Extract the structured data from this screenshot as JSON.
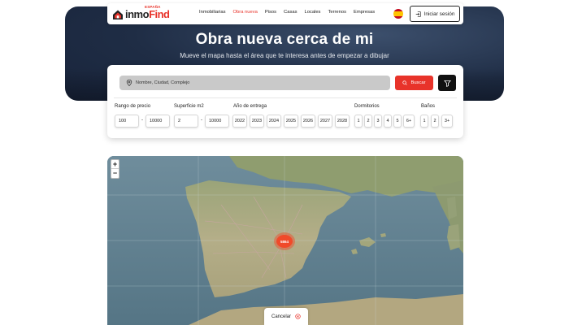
{
  "header": {
    "logo": {
      "brand_main": "inmo",
      "brand_accent": "Find",
      "country": "ESPAÑA"
    },
    "nav": [
      "Inmobiliarias",
      "Obra nueva",
      "Pisos",
      "Casas",
      "Locales",
      "Terrenos",
      "Empresas"
    ],
    "active_nav": "Obra nueva",
    "flag_icon": "spain-flag-icon",
    "login_label": "Iniciar sesión"
  },
  "hero": {
    "title": "Obra nueva cerca de mi",
    "subtitle": "Mueve el mapa hasta el área que te interesa antes de empezar a dibujar"
  },
  "search": {
    "placeholder": "Nombre, Ciudad, Complejo",
    "button_label": "Buscar"
  },
  "filters": {
    "price": {
      "label": "Rango de precio",
      "min": "100",
      "max": "10000"
    },
    "area": {
      "label": "Superficie m2",
      "min": "2",
      "max": "10000"
    },
    "year": {
      "label": "Año de entrega",
      "options": [
        "2022",
        "2023",
        "2024",
        "2025",
        "2026",
        "2027",
        "2028"
      ]
    },
    "bedrooms": {
      "label": "Dormitorios",
      "options": [
        "1",
        "2",
        "3",
        "4",
        "5",
        "6+"
      ]
    },
    "bathrooms": {
      "label": "Baños",
      "options": [
        "1",
        "2",
        "3+"
      ]
    }
  },
  "map": {
    "zoom_in": "+",
    "zoom_out": "−",
    "cluster_label": "5864",
    "cancel_label": "Cancelar"
  },
  "colors": {
    "accent": "#e8332a",
    "hero": "#1f2d45",
    "sea": "#5e7f91",
    "land": "#a7ab83"
  }
}
